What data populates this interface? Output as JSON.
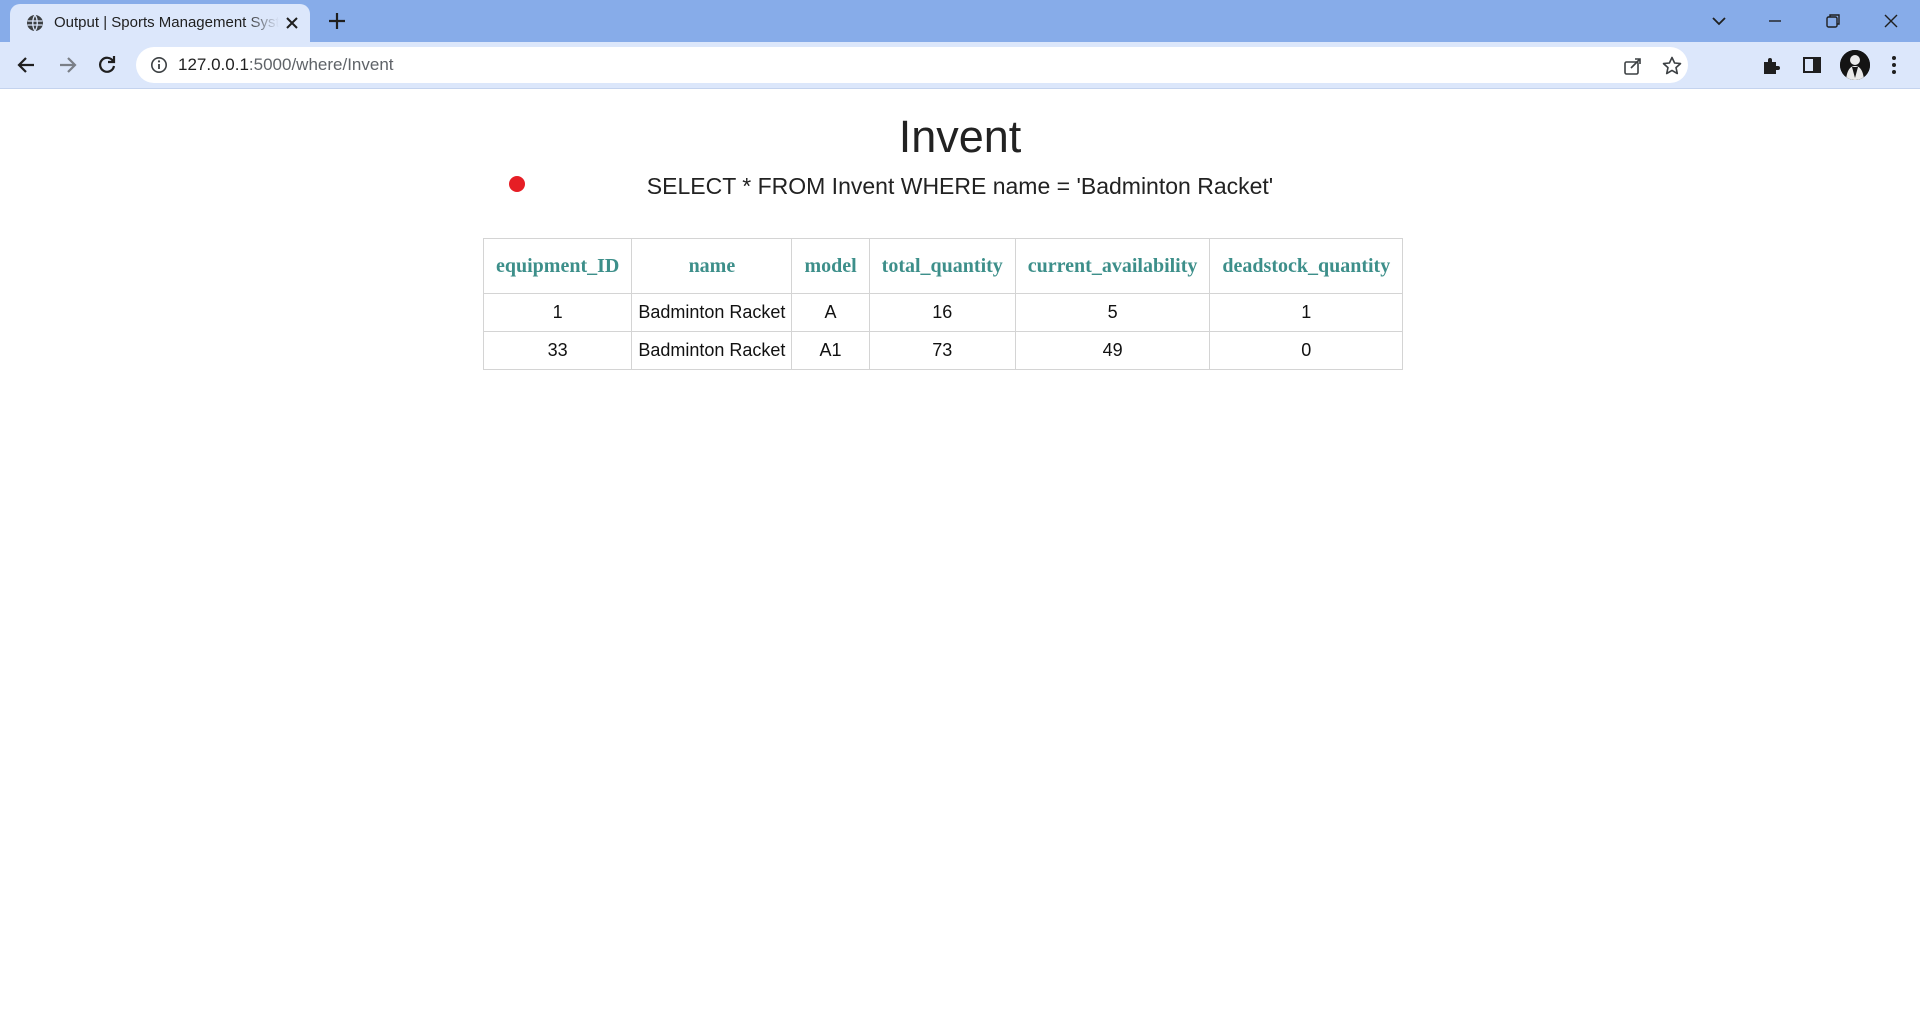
{
  "browser": {
    "tab_title": "Output | Sports Management System",
    "url_host": "127.0.0.1",
    "url_rest": ":5000/where/Invent"
  },
  "page": {
    "title": "Invent",
    "query": "SELECT * FROM Invent WHERE name = 'Badminton Racket'",
    "accent_color": "#3d8f8a",
    "status_dot_color": "#e61e25"
  },
  "table": {
    "headers": [
      "equipment_ID",
      "name",
      "model",
      "total_quantity",
      "current_availability",
      "deadstock_quantity"
    ],
    "rows": [
      [
        "1",
        "Badminton Racket",
        "A",
        "16",
        "5",
        "1"
      ],
      [
        "33",
        "Badminton Racket",
        "A1",
        "73",
        "49",
        "0"
      ]
    ]
  }
}
